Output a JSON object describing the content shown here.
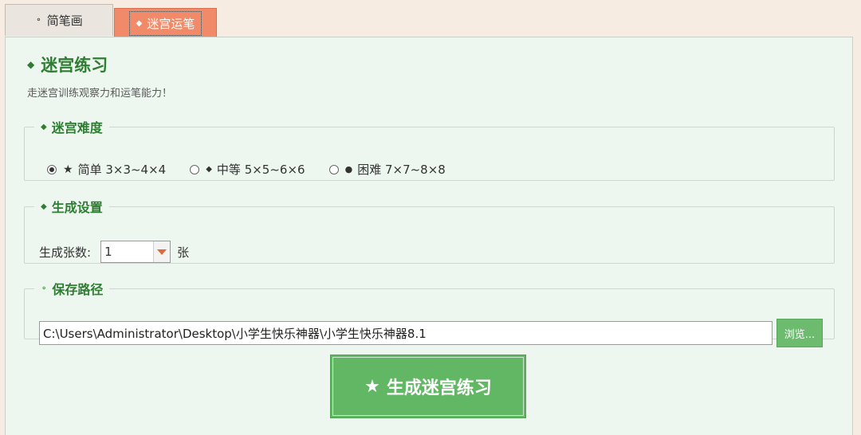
{
  "tabs": [
    {
      "glyph": "⚬",
      "label": "简笔画",
      "icon": "circle-dot-icon"
    },
    {
      "glyph": "◆",
      "label": "迷宫运笔",
      "icon": "diamond-icon"
    }
  ],
  "panel": {
    "title_glyph": "◆",
    "title": "迷宫练习",
    "subtitle": "走迷宫训练观察力和运笔能力！"
  },
  "difficulty": {
    "legend_glyph": "◆",
    "legend": "迷宫难度",
    "options": [
      {
        "glyph": "★",
        "label": "简单 3×3~4×4",
        "checked": true
      },
      {
        "glyph": "◆",
        "label": "中等 5×5~6×6",
        "checked": false
      },
      {
        "glyph": "●",
        "label": "困难 7×7~8×8",
        "checked": false
      }
    ]
  },
  "generate": {
    "legend_glyph": "◆",
    "legend": "生成设置",
    "count_label": "生成张数:",
    "count_value": "1",
    "unit": "张"
  },
  "save": {
    "legend_glyph": "⚬",
    "legend": "保存路径",
    "path": "C:\\Users\\Administrator\\Desktop\\小学生快乐神器\\小学生快乐神器8.1",
    "browse_label": "浏览..."
  },
  "action": {
    "glyph": "★",
    "label": "生成迷宫练习"
  },
  "colors": {
    "accent_green": "#2e7d32",
    "button_green": "#62b765",
    "active_tab": "#f08a68",
    "panel_bg": "#eef7ef"
  }
}
